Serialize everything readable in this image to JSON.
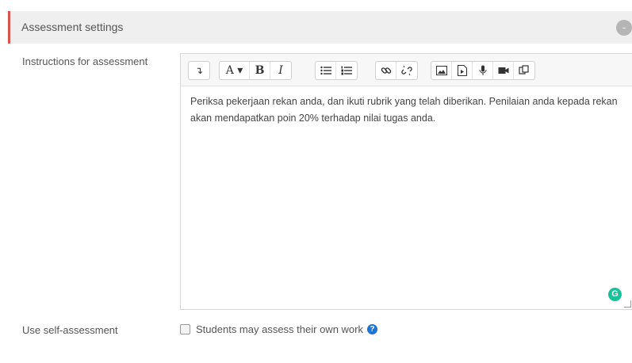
{
  "section": {
    "title": "Assessment settings",
    "collapse_symbol": "-",
    "accent_color": "#d9534f"
  },
  "instructions": {
    "label": "Instructions for assessment",
    "toolbar": {
      "collapse_icon": "↴",
      "font_size": "A ▾",
      "bold": "B",
      "italic": "I",
      "icons": [
        "collapse-icon",
        "font-size-icon",
        "bold-icon",
        "italic-icon",
        "bullet-list-icon",
        "numbered-list-icon",
        "link-icon",
        "unlink-icon",
        "image-icon",
        "media-icon",
        "microphone-icon",
        "video-icon",
        "paste-icon"
      ]
    },
    "content": "Periksa pekerjaan rekan anda, dan ikuti rubrik yang telah diberikan. Penilaian anda kepada rekan akan mendapatkan poin 20% terhadap nilai tugas anda.",
    "grammarly_letter": "G"
  },
  "self_assessment": {
    "label": "Use self-assessment",
    "checkbox_label": "Students may assess their own work",
    "checked": false,
    "help_symbol": "?"
  }
}
